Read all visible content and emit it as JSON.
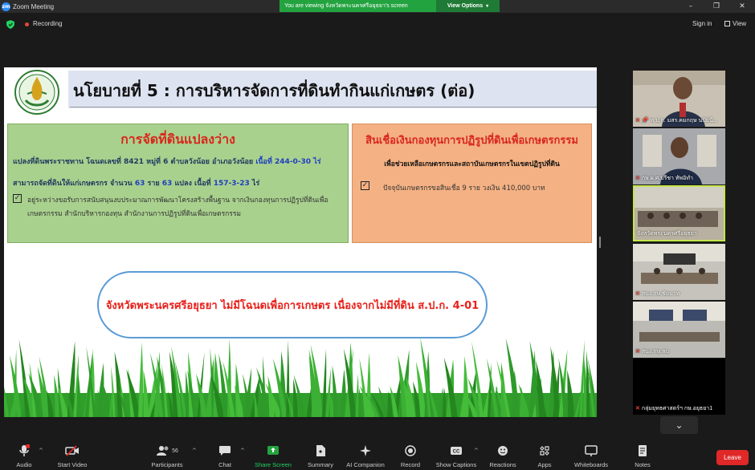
{
  "window": {
    "title": "Zoom Meeting",
    "app_icon": "zm",
    "controls": [
      "minimize-icon",
      "restore-icon",
      "close-icon"
    ]
  },
  "banner": {
    "viewing_text": "You are viewing จังหวัดพระนครศรีอยุธยา's screen",
    "view_options": "View Options"
  },
  "topbar": {
    "recording": "Recording",
    "sign_in": "Sign in",
    "view": "View"
  },
  "slide": {
    "title": "นโยบายที่ 5 :  การบริหารจัดการที่ดินทำกินแก่เกษตร (ต่อ)",
    "left": {
      "heading": "การจัดที่ดินแปลงว่าง",
      "line1_a": "แปลงที่ดินพระราชทาน โฉนดเลขที่ 8421 หมู่ที่ 6 ตำบลวังน้อย อำเภอวังน้อย ",
      "line1_b": "เนื้อที่  244-0-30 ไร่",
      "line2_a": "สามารถจัดที่ดินให้แก่เกษตรกร จำนวน ",
      "line2_b": "63",
      "line2_c": " ราย  ",
      "line2_d": "63",
      "line2_e": " แปลง เนื้อที่ ",
      "line2_f": "157-3-23",
      "line2_g": " ไร่",
      "check": "☑",
      "paragraph": "อยู่ระหว่างขอรับการสนับสนุนงบประมาณการพัฒนาโครงสร้างพื้นฐาน จากเงินกองทุนการปฏิรูปที่ดินเพื่อเกษตรกรรม สำนักบริหารกองทุน สำนักงานการปฏิรูปที่ดินเพื่อเกษตรกรรม"
    },
    "right": {
      "heading": "สินเชื่อเงินกองทุนการปฏิรูปที่ดินเพื่อเกษตรกรรม",
      "sub": "เพื่อช่วยเหลือเกษตรกรและสถาบันเกษตรกรในเขตปฏิรูปที่ดิน",
      "check": "☑",
      "item": "ปัจจุบันเกษตรกรขอสินเชื่อ 9 ราย วงเงิน 410,000 บาท"
    },
    "oval_text": "จังหวัดพระนครศรีอยุธยา ไม่มีโฉนดเพื่อการเกษตร เนื่องจากไม่มีที่ดิน ส.ป.ก. 4-01"
  },
  "gallery": [
    {
      "label": "ห.ป.ก. มสร.คมกฤษ นปัยนี...",
      "muted": true,
      "pinned": true
    },
    {
      "label": "กษ.ผ.ศ.บรีชา ทัพอิทำ",
      "muted": true,
      "pinned": false
    },
    {
      "label": "จังหวัดพระนครศรีอยุธยา",
      "muted": false,
      "pinned": false,
      "active": true
    },
    {
      "label": "สนง.กษ.ชัยนาท",
      "muted": true,
      "pinned": false
    },
    {
      "label": "สนง.กษ.ลบ",
      "muted": true,
      "pinned": false
    },
    {
      "label": "กลุ่มยุทธศาสตร์ฯ กษ.อยุธยา1",
      "muted": true,
      "pinned": false
    }
  ],
  "toolbar": {
    "audio": "Audio",
    "start_video": "Start Video",
    "participants": "Participants",
    "participants_count": "56",
    "chat": "Chat",
    "share_screen": "Share Screen",
    "summary": "Summary",
    "ai_companion": "AI Companion",
    "record": "Record",
    "show_captions": "Show Captions",
    "reactions": "Reactions",
    "apps": "Apps",
    "whiteboards": "Whiteboards",
    "notes": "Notes",
    "leave": "Leave",
    "audio_badge": "!"
  },
  "colors": {
    "banner_green": "#23a340",
    "leave_red": "#e02828",
    "slide_title_band": "#dde3f0",
    "box_left_green": "#a9d18e",
    "box_right_orange": "#f4b183",
    "heading_red": "#d9261c",
    "oval_border": "#5b9bd5",
    "active_tile_border": "#c3e64a"
  }
}
